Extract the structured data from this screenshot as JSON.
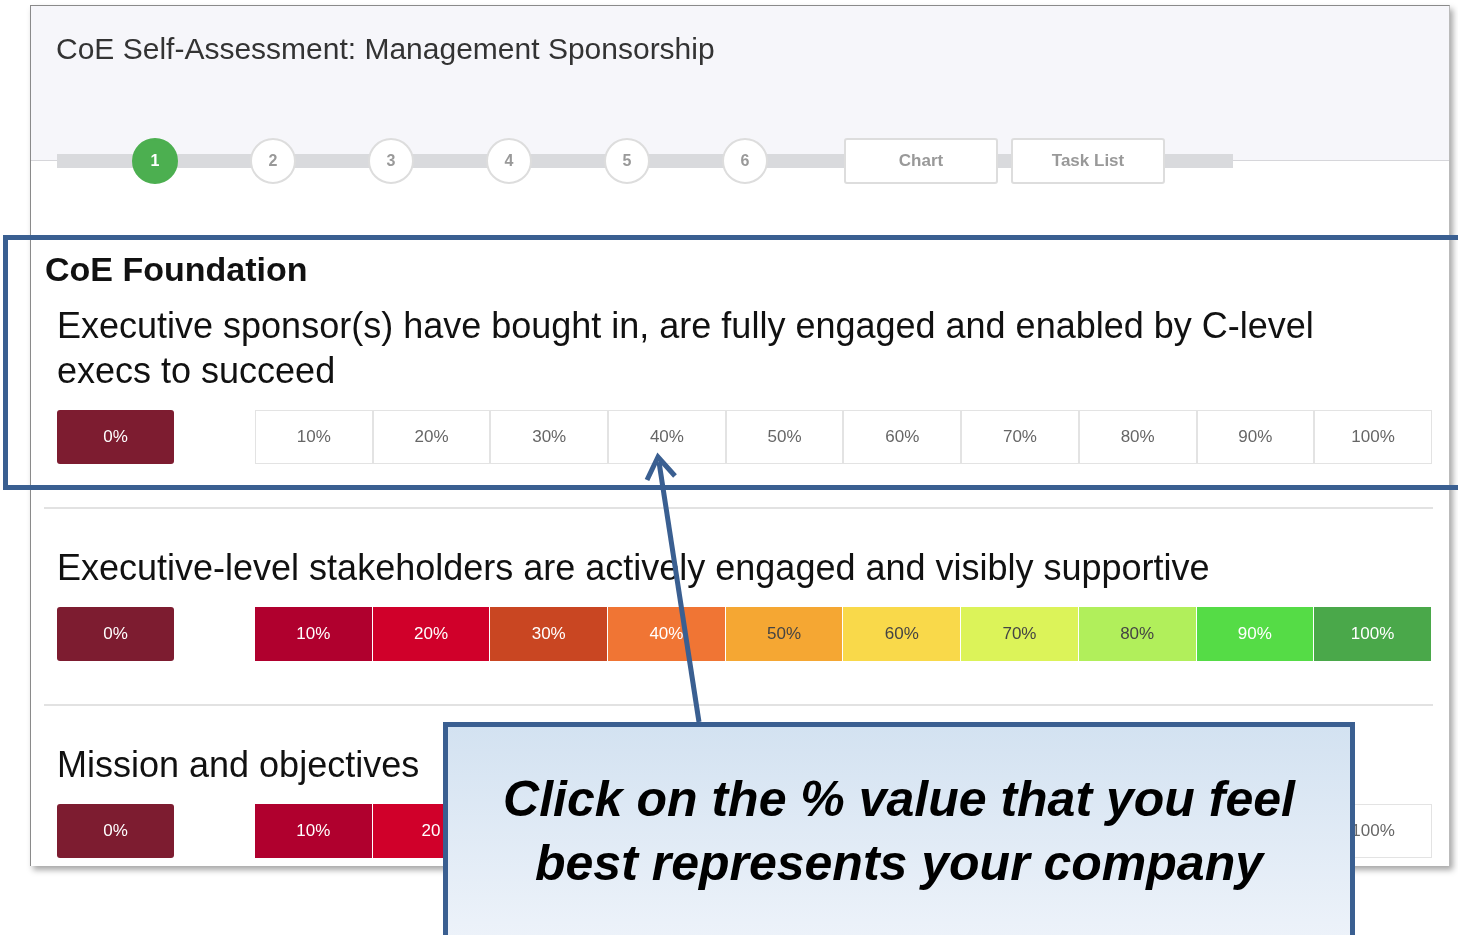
{
  "header": {
    "title": "CoE Self-Assessment: Management Sponsorship"
  },
  "steps": [
    {
      "label": "1",
      "selected": true
    },
    {
      "label": "2",
      "selected": false
    },
    {
      "label": "3",
      "selected": false
    },
    {
      "label": "4",
      "selected": false
    },
    {
      "label": "5",
      "selected": false
    },
    {
      "label": "6",
      "selected": false
    }
  ],
  "step_buttons": [
    "Chart",
    "Task List"
  ],
  "section": {
    "title": "CoE Foundation"
  },
  "questions": [
    {
      "text": "Executive sponsor(s) have bought in, are fully engaged and enabled by C-level execs to succeed",
      "options": [
        {
          "label": "0%",
          "color": "#7d1c30"
        },
        {
          "label": "10%"
        },
        {
          "label": "20%"
        },
        {
          "label": "30%"
        },
        {
          "label": "40%"
        },
        {
          "label": "50%"
        },
        {
          "label": "60%"
        },
        {
          "label": "70%"
        },
        {
          "label": "80%"
        },
        {
          "label": "90%"
        },
        {
          "label": "100%"
        }
      ]
    },
    {
      "text": "Executive-level stakeholders are actively engaged and visibly supportive",
      "options": [
        {
          "label": "0%",
          "color": "#7d1c30"
        },
        {
          "label": "10%",
          "color": "#b0002e"
        },
        {
          "label": "20%",
          "color": "#d0002a"
        },
        {
          "label": "30%",
          "color": "#c94622"
        },
        {
          "label": "40%",
          "color": "#f07534"
        },
        {
          "label": "50%",
          "color": "#f5a733"
        },
        {
          "label": "60%",
          "color": "#f9d94a"
        },
        {
          "label": "70%",
          "color": "#dcf359"
        },
        {
          "label": "80%",
          "color": "#b1ef5b"
        },
        {
          "label": "90%",
          "color": "#55dc46"
        },
        {
          "label": "100%",
          "color": "#4aa84a"
        }
      ]
    },
    {
      "text": "Mission and objectives",
      "options": [
        {
          "label": "0%",
          "color": "#7d1c30"
        },
        {
          "label": "10%",
          "color": "#b0002e"
        },
        {
          "label": "20",
          "color": "#d0002a"
        },
        {
          "label": "100%"
        }
      ]
    }
  ],
  "callout": {
    "text": "Click on the % value that you feel best represents your company"
  }
}
